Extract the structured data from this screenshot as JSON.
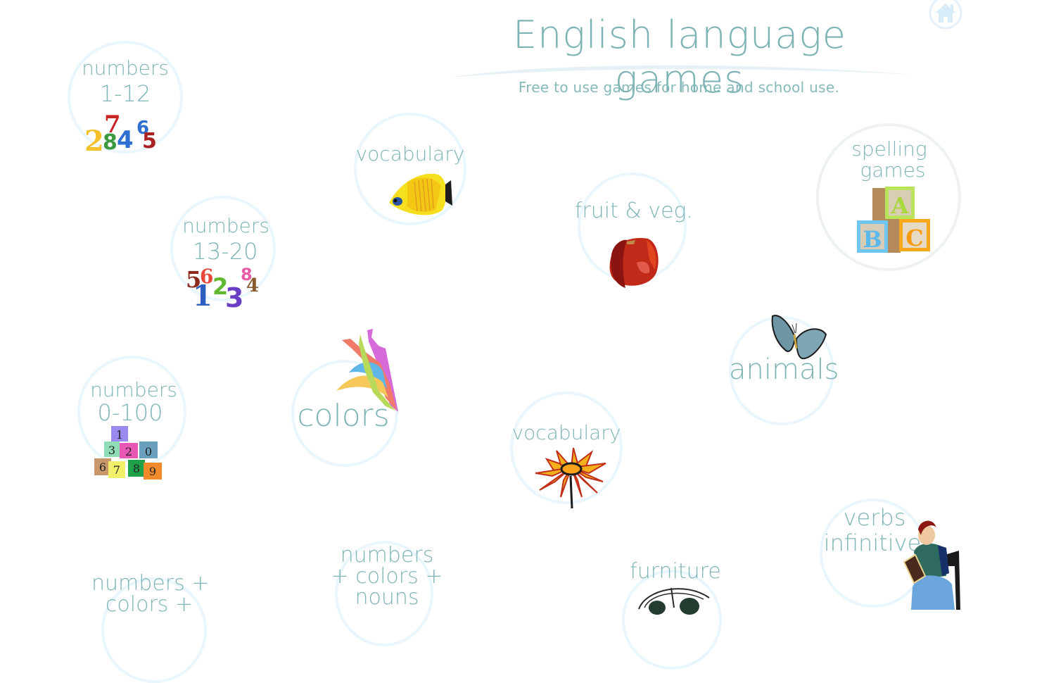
{
  "header": {
    "title": "English language games",
    "subtitle": "Free to use games for home and school use.",
    "home_icon": "home-icon"
  },
  "colors": {
    "text": "#7fb5b6",
    "ring": "#eaf6fd"
  },
  "tiles": {
    "numbers_1_12": {
      "line1": "numbers",
      "line2": "1-12",
      "icon": "3d-numbers-icon"
    },
    "vocabulary_fish": {
      "line1": "vocabulary",
      "icon": "yellow-fish-icon"
    },
    "fruit_veg": {
      "line1": "fruit & veg.",
      "icon": "apple-icon"
    },
    "spelling": {
      "line1": "spelling",
      "line2": "games",
      "icon": "abc-blocks-icon"
    },
    "numbers_13_20": {
      "line1": "numbers",
      "line2": "13-20",
      "icon": "3d-numbers-icon"
    },
    "colors": {
      "line1": "colors",
      "icon": "paint-splash-icon"
    },
    "animals": {
      "line1": "animals",
      "icon": "butterfly-icon"
    },
    "numbers_0_100": {
      "line1": "numbers",
      "line2": "0-100",
      "icon": "number-blocks-icon"
    },
    "vocabulary_flower": {
      "line1": "vocabulary",
      "icon": "flower-icon"
    },
    "verbs": {
      "line1": "verbs",
      "line2": "infinitive",
      "icon": "reading-woman-icon"
    },
    "numbers_colors": {
      "line1": "numbers +",
      "line2": "colors +"
    },
    "numbers_colors_nouns": {
      "line1": "numbers",
      "line2": "+ colors +",
      "line3": "nouns"
    },
    "furniture": {
      "line1": "furniture",
      "icon": "chair-icon"
    }
  }
}
